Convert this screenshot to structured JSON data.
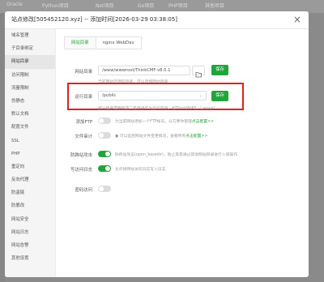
{
  "background": {
    "tabs": [
      "Oracle",
      "Python项目",
      "Net项目",
      "Go项目",
      "PHP项目",
      "其他项目"
    ]
  },
  "modal": {
    "title": "站点修改[505452120.xyz] -- 添加时间[2026-03-29 03:38:05]",
    "close_label": "×"
  },
  "sidebar": {
    "items": [
      {
        "label": "域名管理",
        "active": false
      },
      {
        "label": "子目录绑定",
        "active": false
      },
      {
        "label": "网站目录",
        "active": true
      },
      {
        "label": "访问限制",
        "active": false
      },
      {
        "label": "流量限制",
        "active": false
      },
      {
        "label": "伪静态",
        "active": false
      },
      {
        "label": "默认文档",
        "active": false
      },
      {
        "label": "配置文件",
        "active": false
      },
      {
        "label": "SSL",
        "active": false
      },
      {
        "label": "PHP",
        "active": false
      },
      {
        "label": "重定向",
        "active": false
      },
      {
        "label": "反向代理",
        "active": false
      },
      {
        "label": "防盗链",
        "active": false
      },
      {
        "label": "防篡改",
        "active": false
      },
      {
        "label": "网站安全",
        "active": false
      },
      {
        "label": "网站日志",
        "active": false
      },
      {
        "label": "网站告警",
        "active": false
      },
      {
        "label": "其他设置",
        "active": false
      }
    ]
  },
  "tabs": [
    {
      "label": "网站目录",
      "active": true
    },
    {
      "label": "nginx WebDav",
      "active": false
    }
  ],
  "site_dir": {
    "label": "网站目录",
    "value": "/www/wwwroot/ThinkCMF-v8.0.1",
    "save_label": "保存",
    "hint": "当前网站的源码目录，可以选择网站目录"
  },
  "run_dir": {
    "label": "运行目录",
    "value": "/public",
    "save_label": "保存",
    "hint": "部分程序需要指定二级目录作为运行目录，如ThinkPHP5，Laravel"
  },
  "toggles": [
    {
      "label": "添加FTP",
      "on": false,
      "desc": "为当前网站添加一个FTP帐号，以方便你管理",
      "link": "点击配置>>"
    },
    {
      "label": "文件审计",
      "on": false,
      "desc": "● 可以监控网站文件变更情况，查看所有",
      "link": "点击配置>>"
    },
    {
      "label": "防跨站攻击",
      "on": true,
      "desc": "防跨站攻击(open_basedir)，防止黑客通过其他网站目录进行入侵操作",
      "link": ""
    },
    {
      "label": "写访问日志",
      "on": true,
      "desc": "允许将网站访问日志写入日志",
      "link": ""
    },
    {
      "label": "密码访问",
      "on": false,
      "desc": "",
      "link": ""
    }
  ],
  "colors": {
    "accent": "#20a53a",
    "highlight": "#e02020"
  }
}
